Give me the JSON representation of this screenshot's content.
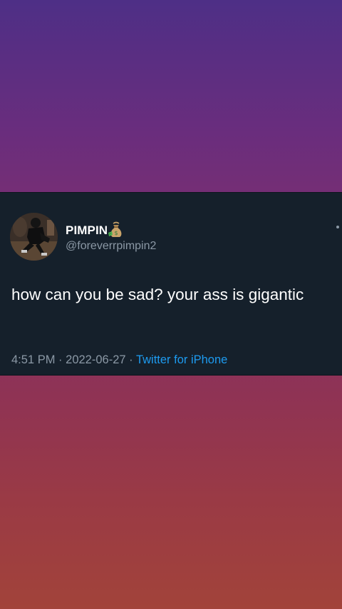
{
  "tweet": {
    "display_name": "PIMPIN",
    "name_emoji_icon": "bag-of-money-emoji-icon",
    "handle": "@foreverrpimpin2",
    "text": "how can you be sad? your ass is gigantic",
    "time": "4:51 PM",
    "separator": "·",
    "date": "2022-06-27",
    "source": "Twitter for iPhone"
  },
  "colors": {
    "card_background": "#15202b",
    "primary_text": "#ffffff",
    "secondary_text": "#8b98a5",
    "link_accent": "#1d9bf0"
  }
}
